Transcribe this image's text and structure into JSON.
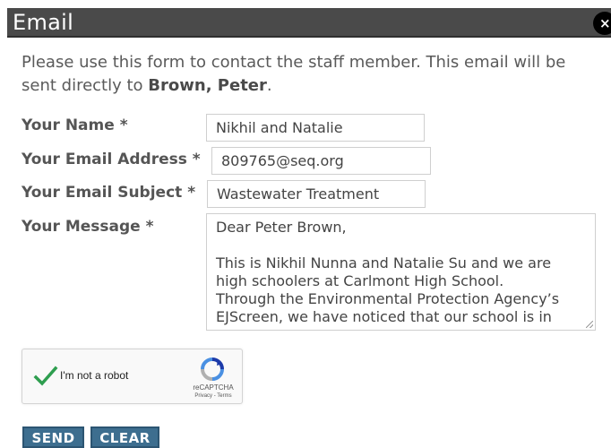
{
  "dialog": {
    "title": "Email",
    "close_label": "×"
  },
  "intro": {
    "text": "Please use this form to contact the staff member. This email will be sent directly to ",
    "recipient": "Brown, Peter",
    "suffix": "."
  },
  "form": {
    "name_label": "Your Name *",
    "name_value": "Nikhil and Natalie",
    "email_label": "Your Email Address *",
    "email_value": "809765@seq.org",
    "subject_label": "Your Email Subject *",
    "subject_value": "Wastewater Treatment",
    "message_label": "Your Message *",
    "message_lines": [
      "Dear Peter Brown,",
      "",
      "This is Nikhil Nunna and Natalie Su and we are",
      "high schoolers at Carlmont High School.",
      "Through the Environmental Protection Agency’s",
      "EJScreen, we have noticed that our school is in"
    ]
  },
  "recaptcha": {
    "label": "I'm not a robot",
    "brand": "reCAPTCHA",
    "terms": "Privacy - Terms",
    "checked": true
  },
  "buttons": {
    "send": "SEND",
    "clear": "CLEAR"
  },
  "colors": {
    "titlebar": "#4a4a4a",
    "button": "#3d6e8f",
    "checkmark": "#2e9e4f"
  }
}
